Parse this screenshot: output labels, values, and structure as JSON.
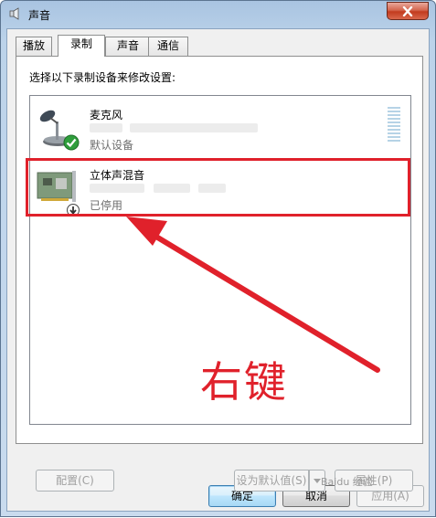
{
  "window": {
    "title": "声音"
  },
  "tabs": [
    {
      "label": "播放",
      "active": false
    },
    {
      "label": "录制",
      "active": true
    },
    {
      "label": "声音",
      "active": false
    },
    {
      "label": "通信",
      "active": false
    }
  ],
  "instruction": "选择以下录制设备来修改设置:",
  "devices": [
    {
      "name": "麦克风",
      "status": "默认设备",
      "icon": "microphone-icon",
      "badge": "default-check-icon"
    },
    {
      "name": "立体声混音",
      "status": "已停用",
      "icon": "sound-card-icon",
      "badge": "disabled-down-arrow-icon"
    }
  ],
  "annotation": {
    "text": "右键",
    "color": "#e0212b"
  },
  "buttons": {
    "configure": "配置(C)",
    "set_default": "设为默认值(S)",
    "properties": "属性(P)",
    "ok": "确定",
    "cancel": "取消",
    "apply": "应用(A)"
  },
  "watermark": "Baidu 经验"
}
